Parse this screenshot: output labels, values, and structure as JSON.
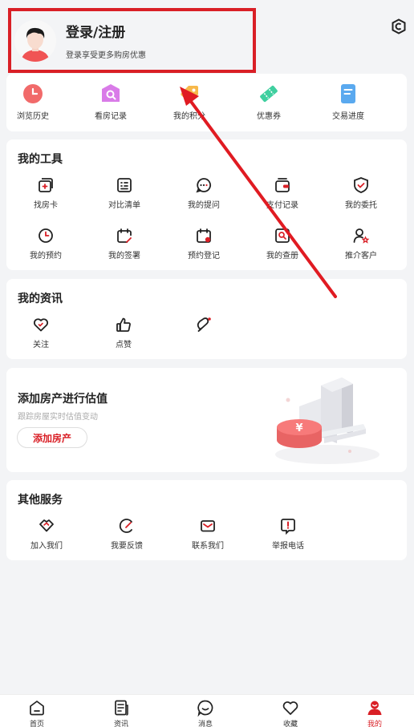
{
  "header": {
    "title": "登录/注册",
    "subtitle": "登录享受更多购房优惠"
  },
  "quick": [
    {
      "label": "浏览历史",
      "icon": "clock-icon",
      "color": "#f16a6a"
    },
    {
      "label": "看房记录",
      "icon": "search-house-icon",
      "color": "#d97be8"
    },
    {
      "label": "我的积分",
      "icon": "tag-icon",
      "color": "#f7b84a"
    },
    {
      "label": "优惠券",
      "icon": "coupon-icon",
      "color": "#3fcf9f"
    },
    {
      "label": "交易进度",
      "icon": "document-icon",
      "color": "#5aa9ef"
    }
  ],
  "tools": {
    "title": "我的工具",
    "items": [
      {
        "label": "找房卡",
        "icon": "house-card-icon"
      },
      {
        "label": "对比清单",
        "icon": "compare-list-icon"
      },
      {
        "label": "我的提问",
        "icon": "question-chat-icon"
      },
      {
        "label": "支付记录",
        "icon": "wallet-icon"
      },
      {
        "label": "我的委托",
        "icon": "shield-check-icon"
      },
      {
        "label": "我的预约",
        "icon": "clock-icon"
      },
      {
        "label": "我的签署",
        "icon": "sign-calendar-icon"
      },
      {
        "label": "预约登记",
        "icon": "register-calendar-icon"
      },
      {
        "label": "我的查册",
        "icon": "search-doc-icon"
      },
      {
        "label": "推介客户",
        "icon": "user-star-icon"
      }
    ]
  },
  "news": {
    "title": "我的资讯",
    "items": [
      {
        "label": "关注",
        "icon": "heart-icon"
      },
      {
        "label": "点赞",
        "icon": "thumbs-up-icon"
      },
      {
        "label": "",
        "icon": "comment-icon"
      }
    ]
  },
  "estimate": {
    "title": "添加房产进行估值",
    "subtitle": "跟踪房屋实时估值变动",
    "button": "添加房产"
  },
  "other": {
    "title": "其他服务",
    "items": [
      {
        "label": "加入我们",
        "icon": "handshake-icon"
      },
      {
        "label": "我要反馈",
        "icon": "feedback-icon"
      },
      {
        "label": "联系我们",
        "icon": "mail-icon"
      },
      {
        "label": "举报电话",
        "icon": "report-icon"
      }
    ]
  },
  "tabbar": [
    {
      "label": "首页",
      "icon": "home-icon",
      "active": false
    },
    {
      "label": "资讯",
      "icon": "news-icon",
      "active": false
    },
    {
      "label": "消息",
      "icon": "message-icon",
      "active": false
    },
    {
      "label": "收藏",
      "icon": "heart-icon",
      "active": false
    },
    {
      "label": "我的",
      "icon": "profile-icon",
      "active": true
    }
  ],
  "colors": {
    "accent": "#d91f26",
    "background": "#f3f4f6"
  }
}
